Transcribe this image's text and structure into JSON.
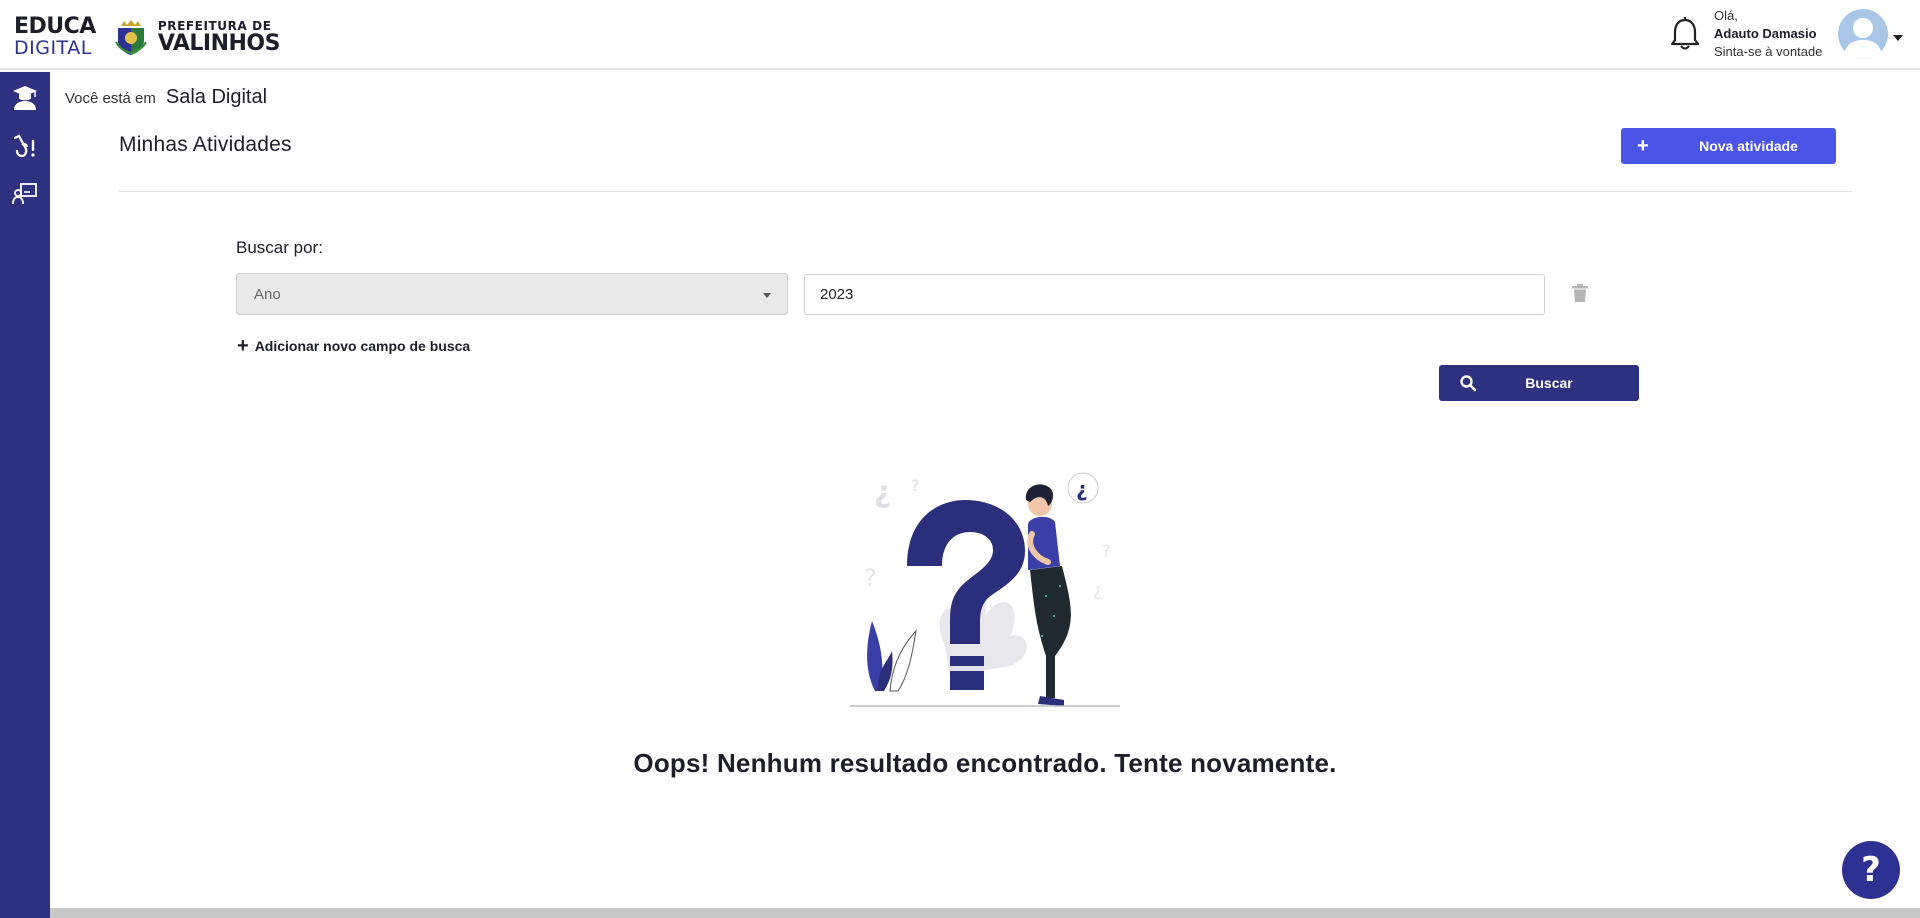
{
  "header": {
    "brand_line1": "EDUCA",
    "brand_line2": "DIGITAL",
    "prefeitura_line1": "PREFEITURA DE",
    "prefeitura_line2": "VALINHOS",
    "greeting": "Olá,",
    "user_name": "Adauto Damasio",
    "user_subtitle": "Sinta-se à vontade"
  },
  "breadcrumb": {
    "prefix": "Você está em",
    "current": "Sala Digital"
  },
  "page": {
    "title": "Minhas Atividades",
    "new_activity_label": "Nova atividade"
  },
  "search": {
    "label": "Buscar por:",
    "field_selected": "Ano",
    "field_value": "2023",
    "add_field_label": "Adicionar novo campo de busca",
    "button_label": "Buscar"
  },
  "empty_state": {
    "message": "Oops! Nenhum resultado encontrado. Tente novamente."
  },
  "help": {
    "label": "?"
  },
  "colors": {
    "sidebar": "#2e3180",
    "primary_button": "#4a55e8",
    "search_button": "#2e3180",
    "help_button": "#2e3192"
  },
  "icons": {
    "sidebar": [
      "graduation-student-icon",
      "hand-activity-icon",
      "teacher-board-icon"
    ],
    "header": [
      "bell-icon",
      "avatar",
      "chevron-down-icon"
    ]
  }
}
